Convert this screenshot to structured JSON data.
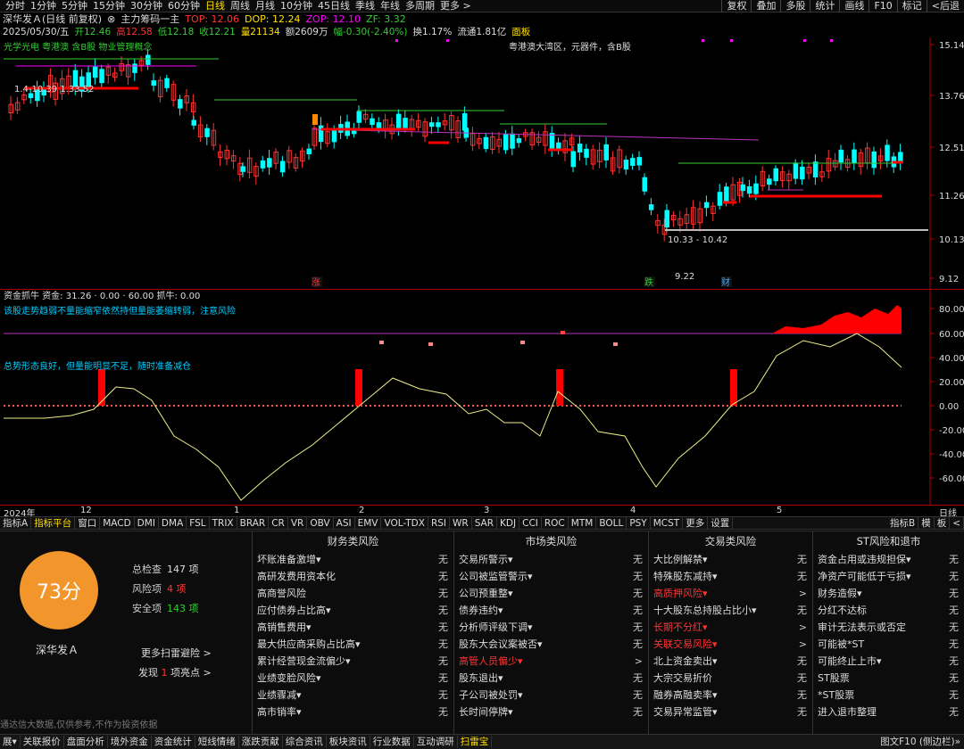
{
  "toolbar": {
    "periods": [
      "分时",
      "1分钟",
      "5分钟",
      "15分钟",
      "30分钟",
      "60分钟",
      "日线",
      "周线",
      "月线",
      "10分钟",
      "45日线",
      "季线",
      "年线",
      "多周期",
      "更多 >"
    ],
    "active": "日线",
    "right": [
      "复权",
      "叠加",
      "多股",
      "统计",
      "画线",
      "F10",
      "标记",
      "<后退"
    ]
  },
  "info": {
    "stock": "深华发Ａ(日线 前复权)",
    "indicator": "主力筹码一主",
    "top": "TOP: 12.06",
    "dop": "DOP: 12.24",
    "zop": "ZOP: 12.10",
    "zf": "ZF: 3.32",
    "date": "2025/05/30/五",
    "open": "开12.46",
    "high": "高12.58",
    "low": "低12.18",
    "close": "收12.21",
    "vol": "量21134",
    "amount": "额2609万",
    "change": "幅-0.30(-2.40%)",
    "turnover": "换1.17%",
    "float": "流通1.81亿",
    "board": "面板"
  },
  "main_chart": {
    "concepts": "光学光电 粤港澳 含B股 物业管理概念",
    "tag_text": "粤港澳大湾区，元器件，含B股",
    "price_note": "1.4-10.39 1.33.52",
    "price_labels": [
      "15.14",
      "13.76",
      "12.51",
      "11.26",
      "10.13",
      "9.12"
    ],
    "range_label": "10.33 - 10.42",
    "low_label": "9.22",
    "markers": [
      "涨",
      "跌",
      "财"
    ]
  },
  "sub_chart": {
    "title": "资金抓牛 资金: 31.26 · 0.00 · 60.00 抓牛: 0.00",
    "msg1": "该股走势趋弱不量能缩窄依然持但量能萎缩转弱，注意风险",
    "msg2": "总势形态良好，但量能明显不足，随时准备减仓",
    "y_labels": [
      "80.00",
      "60.00",
      "40.00",
      "20.00",
      "0.00",
      "-20.00",
      "-40.00",
      "-60.00"
    ]
  },
  "time_axis": {
    "labels": [
      "2024年",
      "12",
      "1",
      "2",
      "3",
      "4",
      "5"
    ],
    "right": "日线"
  },
  "tabs": {
    "items": [
      "指标A",
      "指标平台",
      "窗口",
      "MACD",
      "DMI",
      "DMA",
      "FSL",
      "TRIX",
      "BRAR",
      "CR",
      "VR",
      "OBV",
      "ASI",
      "EMV",
      "VOL-TDX",
      "RSI",
      "WR",
      "SAR",
      "KDJ",
      "CCI",
      "ROC",
      "MTM",
      "BOLL",
      "PSY",
      "MCST",
      "更多",
      "设置"
    ],
    "right": [
      "指标B",
      "模",
      "板",
      "<"
    ]
  },
  "risk": {
    "score": "73分",
    "name": "深华发Ａ",
    "total_label": "总检查",
    "total": "147 项",
    "risk_label": "风险项",
    "risk": "4 项",
    "safe_label": "安全项",
    "safe": "143 项",
    "more": "更多扫雷避险 >",
    "found_pre": "发现",
    "found_num": "1",
    "found_post": "项亮点 >",
    "disclaimer": "通达信大数据,仅供参考,不作为投资依据",
    "columns": [
      {
        "title": "财务类风险",
        "rows": [
          {
            "l": "坏账准备激增▾",
            "v": "无"
          },
          {
            "l": "高研发费用资本化",
            "v": "无"
          },
          {
            "l": "高商誉风险",
            "v": "无"
          },
          {
            "l": "应付债券占比高▾",
            "v": "无"
          },
          {
            "l": "高销售费用▾",
            "v": "无"
          },
          {
            "l": "最大供应商采购占比高▾",
            "v": "无"
          },
          {
            "l": "累计经营现金流偏少▾",
            "v": "无"
          },
          {
            "l": "业绩变脸风险▾",
            "v": "无"
          },
          {
            "l": "业绩骤减▾",
            "v": "无"
          },
          {
            "l": "高市销率▾",
            "v": "无"
          }
        ]
      },
      {
        "title": "市场类风险",
        "rows": [
          {
            "l": "交易所警示▾",
            "v": "无"
          },
          {
            "l": "公司被监管警示▾",
            "v": "无"
          },
          {
            "l": "公司预重整▾",
            "v": "无"
          },
          {
            "l": "债券违约▾",
            "v": "无"
          },
          {
            "l": "分析师评级下调▾",
            "v": "无"
          },
          {
            "l": "股东大会议案被否▾",
            "v": "无"
          },
          {
            "l": "高管人员偏少▾",
            "v": ">",
            "hot": true
          },
          {
            "l": "股东退出▾",
            "v": "无"
          },
          {
            "l": "子公司被处罚▾",
            "v": "无"
          },
          {
            "l": "长时间停牌▾",
            "v": "无"
          }
        ]
      },
      {
        "title": "交易类风险",
        "rows": [
          {
            "l": "大比例解禁▾",
            "v": "无"
          },
          {
            "l": "特殊股东减持▾",
            "v": "无"
          },
          {
            "l": "高质押风险▾",
            "v": ">",
            "hot": true
          },
          {
            "l": "十大股东总持股占比小▾",
            "v": "无"
          },
          {
            "l": "长期不分红▾",
            "v": ">",
            "hot": true
          },
          {
            "l": "关联交易风险▾",
            "v": ">",
            "hot": true
          },
          {
            "l": "北上资金卖出▾",
            "v": "无"
          },
          {
            "l": "大宗交易折价",
            "v": "无"
          },
          {
            "l": "融券高融卖率▾",
            "v": "无"
          },
          {
            "l": "交易异常监管▾",
            "v": "无"
          }
        ]
      },
      {
        "title": "ST风险和退市",
        "rows": [
          {
            "l": "资金占用或违规担保▾",
            "v": "无"
          },
          {
            "l": "净资产可能低于亏损▾",
            "v": "无"
          },
          {
            "l": "财务造假▾",
            "v": "无"
          },
          {
            "l": "分红不达标",
            "v": "无"
          },
          {
            "l": "审计无法表示或否定",
            "v": "无"
          },
          {
            "l": "可能被*ST",
            "v": "无"
          },
          {
            "l": "可能终止上市▾",
            "v": "无"
          },
          {
            "l": "ST股票",
            "v": "无"
          },
          {
            "l": "*ST股票",
            "v": "无"
          },
          {
            "l": "进入退市整理",
            "v": "无"
          }
        ]
      }
    ]
  },
  "bottom": {
    "items": [
      "展▾",
      "关联报价",
      "盘面分析",
      "境外资金",
      "资金统计",
      "短线情绪",
      "涨跌贡献",
      "综合资讯",
      "板块资讯",
      "行业数据",
      "互动调研",
      "扫雷宝"
    ],
    "active": "扫雷宝",
    "right": "图文F10 (侧边栏)»"
  }
}
